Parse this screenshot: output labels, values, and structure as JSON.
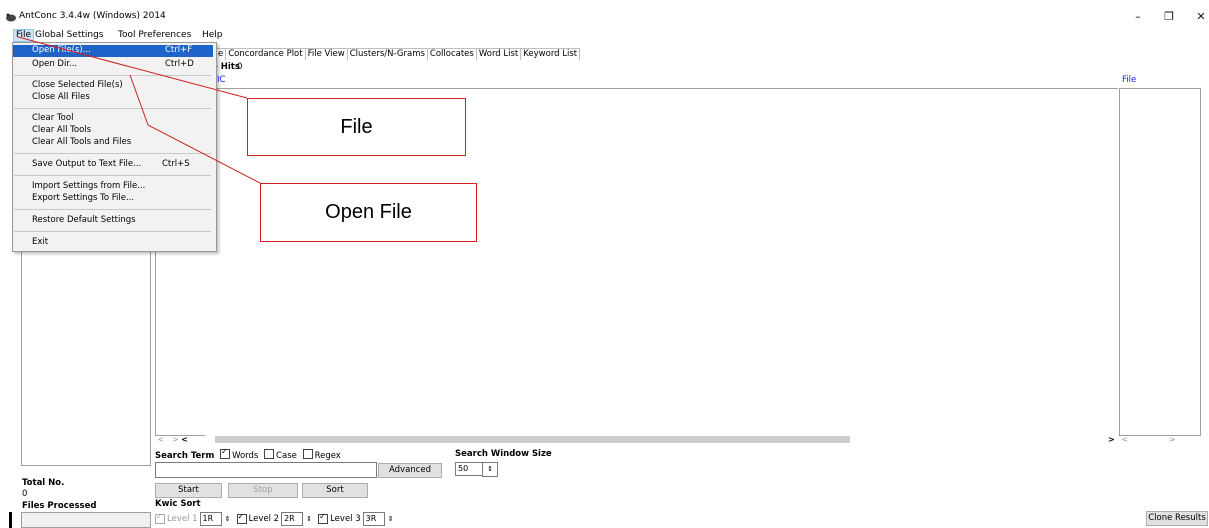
{
  "window": {
    "title": "AntConc 3.4.4w (Windows) 2014",
    "controls": {
      "minimize": "–",
      "restore": "❐",
      "close": "✕"
    }
  },
  "menubar": {
    "file": "File",
    "global_settings": "Global Settings",
    "tool_preferences": "Tool Preferences",
    "help": "Help"
  },
  "tabs": [
    "e",
    "Concordance Plot",
    "File View",
    "Clusters/N-Grams",
    "Collocates",
    "Word List",
    "Keyword List"
  ],
  "results": {
    "hits_label": "e Hits",
    "hits_value": "0",
    "kwic_header": "IC",
    "file_header": "File"
  },
  "file_menu": {
    "items": [
      {
        "label": "Open File(s)...",
        "shortcut": "Ctrl+F"
      },
      {
        "label": "Open Dir...",
        "shortcut": "Ctrl+D"
      },
      {
        "label": "Close Selected File(s)",
        "shortcut": ""
      },
      {
        "label": "Close All Files",
        "shortcut": ""
      },
      {
        "label": "Clear Tool",
        "shortcut": ""
      },
      {
        "label": "Clear All Tools",
        "shortcut": ""
      },
      {
        "label": "Clear All Tools and Files",
        "shortcut": ""
      },
      {
        "label": "Save Output to Text File...",
        "shortcut": "Ctrl+S"
      },
      {
        "label": "Import Settings from File...",
        "shortcut": ""
      },
      {
        "label": "Export Settings To File...",
        "shortcut": ""
      },
      {
        "label": "Restore Default Settings",
        "shortcut": ""
      },
      {
        "label": "Exit",
        "shortcut": ""
      }
    ]
  },
  "callouts": {
    "file": "File",
    "open_file": "Open File"
  },
  "left_panel": {
    "total_no_label": "Total No.",
    "total_no_value": "0",
    "files_processed_label": "Files Processed"
  },
  "search": {
    "term_label": "Search Term",
    "words_label": "Words",
    "words_checked": true,
    "case_label": "Case",
    "case_checked": false,
    "regex_label": "Regex",
    "regex_checked": false,
    "value": "",
    "advanced_button": "Advanced",
    "window_size_label": "Search Window Size",
    "window_size_value": "50"
  },
  "buttons": {
    "start": "Start",
    "stop": "Stop",
    "sort": "Sort",
    "clone_results": "Clone Results"
  },
  "kwic_sort": {
    "label": "Kwic Sort",
    "level1_label": "Level 1",
    "level1_value": "1R",
    "level2_label": "Level 2",
    "level2_value": "2R",
    "level3_label": "Level 3",
    "level3_value": "3R"
  },
  "colors": {
    "callout_border": "#d02020",
    "menu_highlight": "#1e63c8",
    "header_blue": "#1a1aff"
  }
}
